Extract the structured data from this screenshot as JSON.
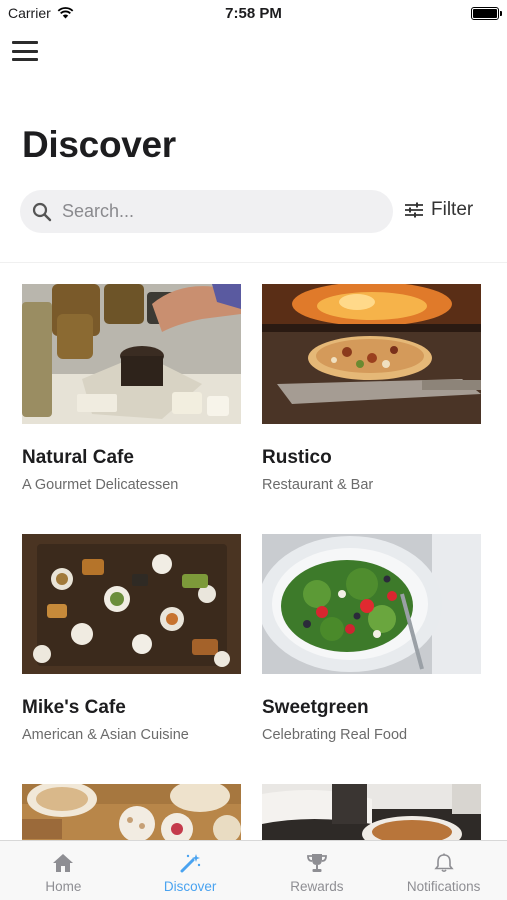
{
  "status_bar": {
    "carrier": "Carrier",
    "time": "7:58 PM"
  },
  "header": {
    "title": "Discover"
  },
  "search": {
    "placeholder": "Search...",
    "icon": "search-icon"
  },
  "filter": {
    "label": "Filter",
    "icon": "sliders-icon"
  },
  "places": [
    {
      "name": "Natural Cafe",
      "subtitle": "A Gourmet Delicatessen"
    },
    {
      "name": "Rustico",
      "subtitle": "Restaurant & Bar"
    },
    {
      "name": "Mike's Cafe",
      "subtitle": "American & Asian Cuisine"
    },
    {
      "name": "Sweetgreen",
      "subtitle": "Celebrating Real Food"
    },
    {
      "name": "",
      "subtitle": ""
    },
    {
      "name": "",
      "subtitle": ""
    }
  ],
  "tabs": [
    {
      "label": "Home",
      "icon": "home-icon",
      "active": false
    },
    {
      "label": "Discover",
      "icon": "magic-wand-icon",
      "active": true
    },
    {
      "label": "Rewards",
      "icon": "trophy-icon",
      "active": false
    },
    {
      "label": "Notifications",
      "icon": "bell-icon",
      "active": false
    }
  ],
  "colors": {
    "accent": "#4aa3f0",
    "inactive_tab": "#8e8e93",
    "search_bg": "#f0f0f2"
  }
}
